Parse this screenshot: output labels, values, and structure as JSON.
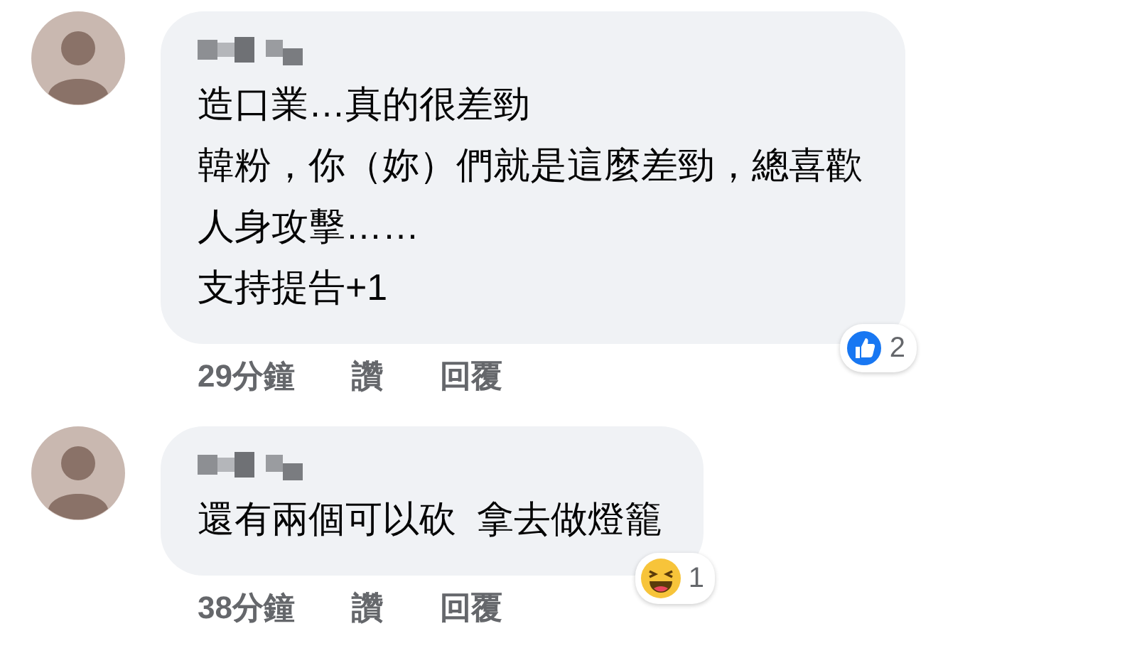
{
  "comments": [
    {
      "lines": [
        "造口業…真的很差勁",
        "韓粉，你（妳）們就是這麼差勁，總喜歡",
        "人身攻擊……",
        "支持提告+1"
      ],
      "time": "29分鐘",
      "actions": [
        "讚",
        "回覆"
      ],
      "reaction": {
        "kind": "like",
        "count": "2"
      }
    },
    {
      "lines": [
        "還有兩個可以砍  拿去做燈籠"
      ],
      "time": "38分鐘",
      "actions": [
        "讚",
        "回覆"
      ],
      "reaction": {
        "kind": "haha",
        "count": "1"
      }
    }
  ]
}
